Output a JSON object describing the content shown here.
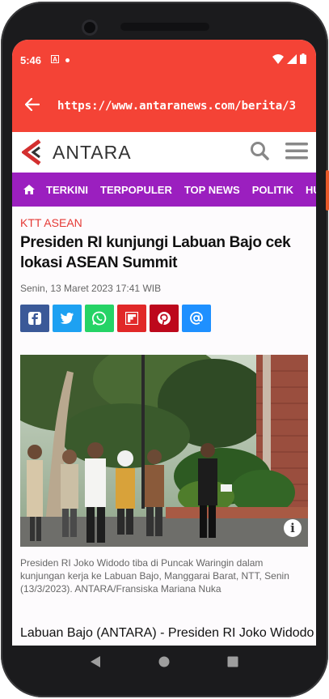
{
  "status": {
    "time": "5:46"
  },
  "browser": {
    "url": "https://www.antaranews.com/berita/3"
  },
  "site": {
    "logo_text": "ANTARA"
  },
  "nav": {
    "items": [
      "TERKINI",
      "TERPOPULER",
      "TOP NEWS",
      "POLITIK",
      "HUKUM"
    ]
  },
  "article": {
    "category": "KTT ASEAN",
    "title": "Presiden RI kunjungi Labuan Bajo cek lokasi ASEAN Summit",
    "date": "Senin, 13 Maret 2023 17:41 WIB",
    "caption": "Presiden RI Joko Widodo tiba di Puncak Waringin dalam kunjungan kerja ke Labuan Bajo, Manggarai Barat, NTT, Senin (13/3/2023). ANTARA/Fransiska Mariana Nuka",
    "lead": "Labuan Bajo (ANTARA) - Presiden RI Joko Widodo"
  },
  "share": [
    {
      "name": "facebook",
      "color": "#3b5998"
    },
    {
      "name": "twitter",
      "color": "#1da1f2"
    },
    {
      "name": "whatsapp",
      "color": "#25d366"
    },
    {
      "name": "flipboard",
      "color": "#e12828"
    },
    {
      "name": "pinterest",
      "color": "#bd081c"
    },
    {
      "name": "email",
      "color": "#1e90ff"
    }
  ],
  "colors": {
    "accent": "#f44336",
    "nav": "#9b1fbf",
    "category": "#e53935"
  }
}
